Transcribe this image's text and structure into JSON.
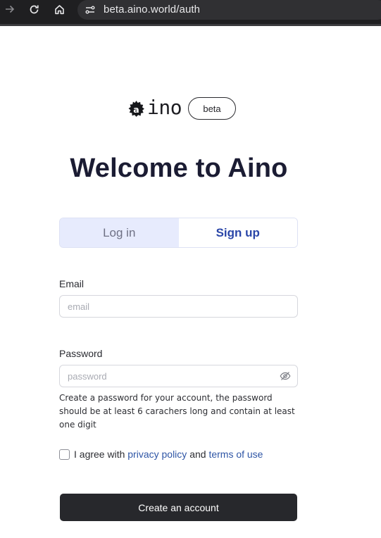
{
  "browser": {
    "url": "beta.aino.world/auth",
    "icons": [
      "arrow-forward-icon",
      "reload-icon",
      "home-icon",
      "site-settings-icon"
    ]
  },
  "brand": {
    "logo_text": "ino",
    "badge": "beta"
  },
  "heading": "Welcome to Aino",
  "tabs": {
    "login": "Log in",
    "signup": "Sign up",
    "active": "signup"
  },
  "form": {
    "email_label": "Email",
    "email_placeholder": "email",
    "password_label": "Password",
    "password_placeholder": "password",
    "password_hint": "Create a password for your account, the password should be at least 6 carachers long and contain at least one digit",
    "agree_prefix": "I agree with",
    "privacy_link": "privacy policy",
    "agree_and": "and",
    "terms_link": "terms of use",
    "agree_checked": false,
    "submit": "Create an account"
  },
  "colors": {
    "accent": "#2a46a8",
    "tab_inactive_bg": "#e7ebfd",
    "link": "#2f56a6",
    "button_bg": "#27282c",
    "heading": "#1b1c33"
  }
}
